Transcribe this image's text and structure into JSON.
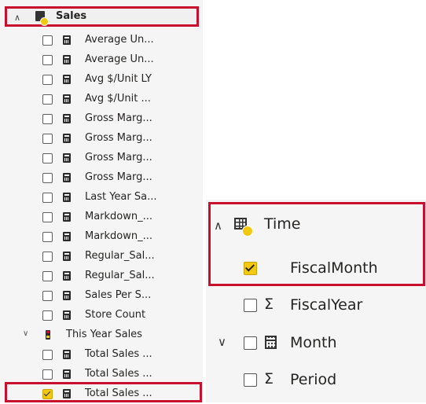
{
  "sales_table": {
    "name": "Sales",
    "measures": [
      "Average Un...",
      "Average Un...",
      "Avg $/Unit LY",
      "Avg $/Unit ...",
      "Gross Marg...",
      "Gross Marg...",
      "Gross Marg...",
      "Gross Marg...",
      "Last Year Sa...",
      "Markdown_...",
      "Markdown_...",
      "Regular_Sal...",
      "Regular_Sal...",
      "Sales Per S...",
      "Store Count"
    ],
    "folder": {
      "name": "This Year Sales",
      "items": [
        {
          "label": "Total Sales ...",
          "checked": false
        },
        {
          "label": "Total Sales ...",
          "checked": false
        },
        {
          "label": "Total Sales ...",
          "checked": true
        }
      ]
    }
  },
  "time_table": {
    "name": "Time",
    "fields": [
      {
        "label": "FiscalMonth",
        "checked": true,
        "icon": "none"
      },
      {
        "label": "FiscalYear",
        "checked": false,
        "icon": "sigma-icon"
      },
      {
        "label": "Month",
        "checked": false,
        "icon": "calendar-icon"
      },
      {
        "label": "Period",
        "checked": false,
        "icon": "sigma-icon"
      }
    ]
  },
  "colors": {
    "highlight_border": "#c8102e",
    "checked_fill": "#f2c811",
    "panel_bg": "#f5f5f5"
  }
}
